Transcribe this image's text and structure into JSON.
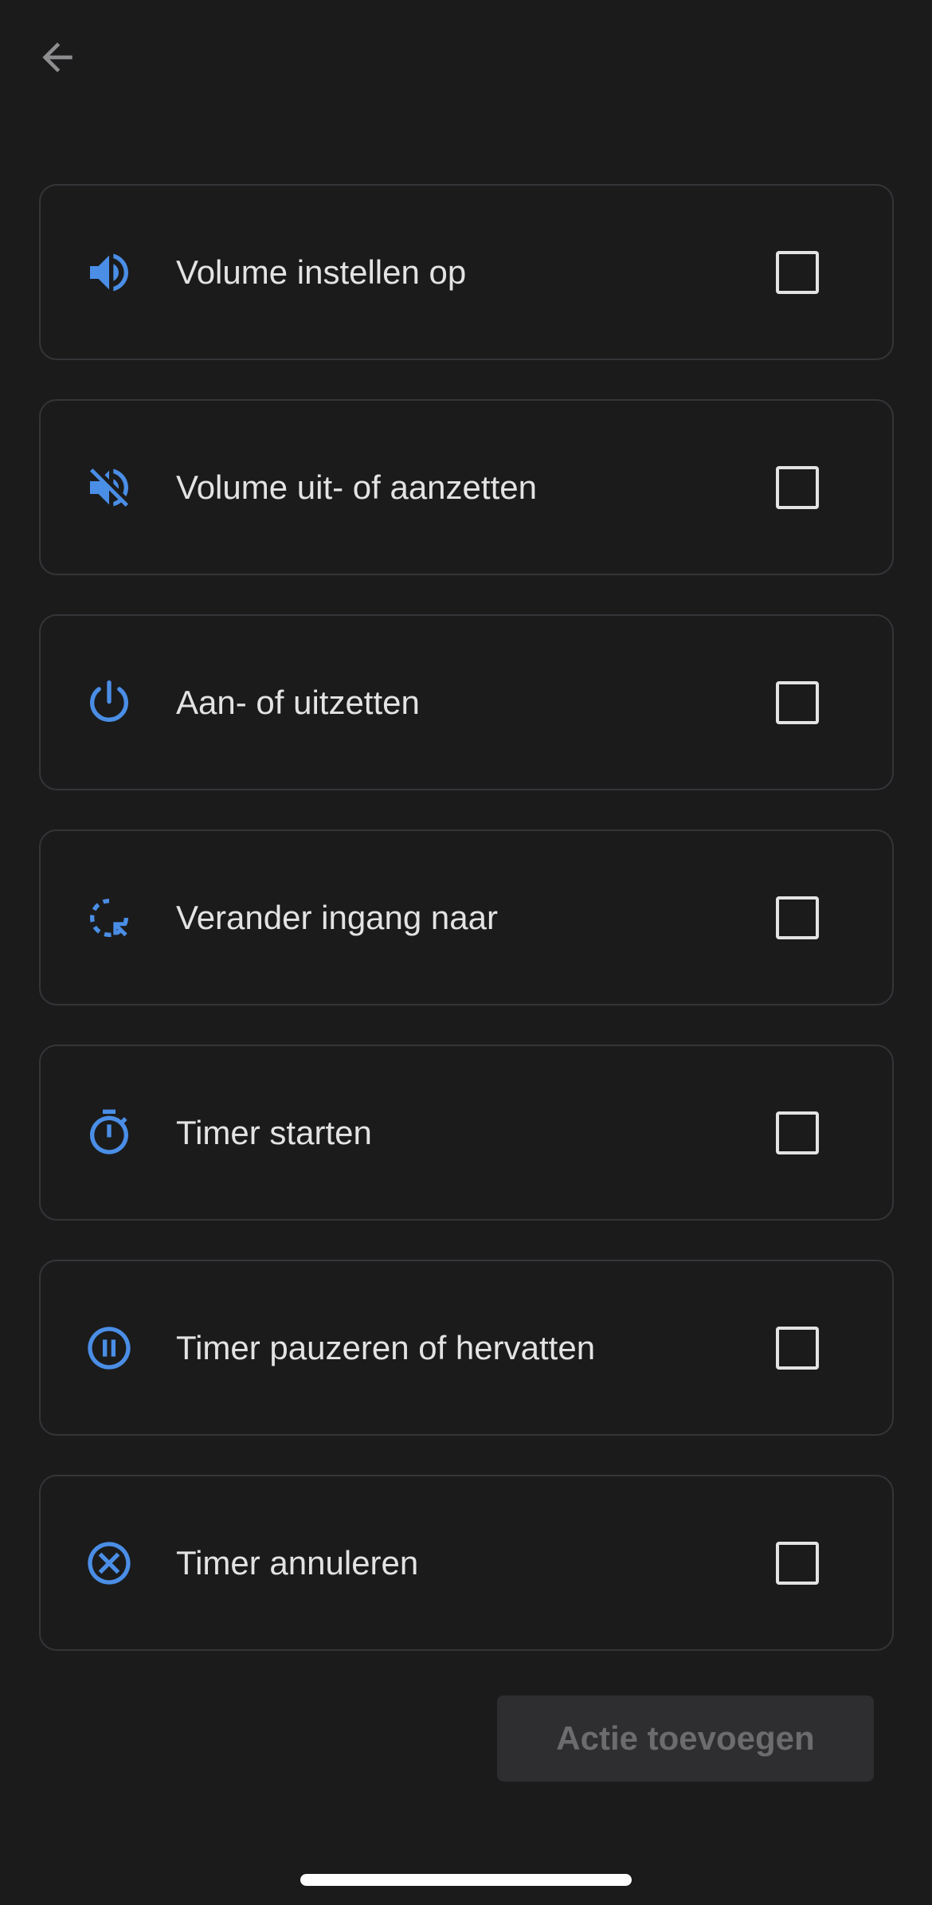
{
  "colors": {
    "background": "#1b1b1c",
    "card_border": "#343538",
    "icon_blue": "#4a8ee6",
    "text": "#e3e3e3",
    "button_disabled_bg": "#2e2e30",
    "button_disabled_text": "#6c6c6e"
  },
  "header": {
    "back_icon": "arrow-back-icon"
  },
  "actions": [
    {
      "icon": "volume-up-icon",
      "label": "Volume instellen op",
      "checked": false
    },
    {
      "icon": "volume-off-icon",
      "label": "Volume uit- of aanzetten",
      "checked": false
    },
    {
      "icon": "power-icon",
      "label": "Aan- of uitzetten",
      "checked": false
    },
    {
      "icon": "input-select-icon",
      "label": "Verander ingang naar",
      "checked": false
    },
    {
      "icon": "timer-icon",
      "label": "Timer starten",
      "checked": false
    },
    {
      "icon": "pause-circle-icon",
      "label": "Timer pauzeren of hervatten",
      "checked": false
    },
    {
      "icon": "cancel-circle-icon",
      "label": "Timer annuleren",
      "checked": false
    }
  ],
  "footer": {
    "add_button_label": "Actie toevoegen"
  }
}
